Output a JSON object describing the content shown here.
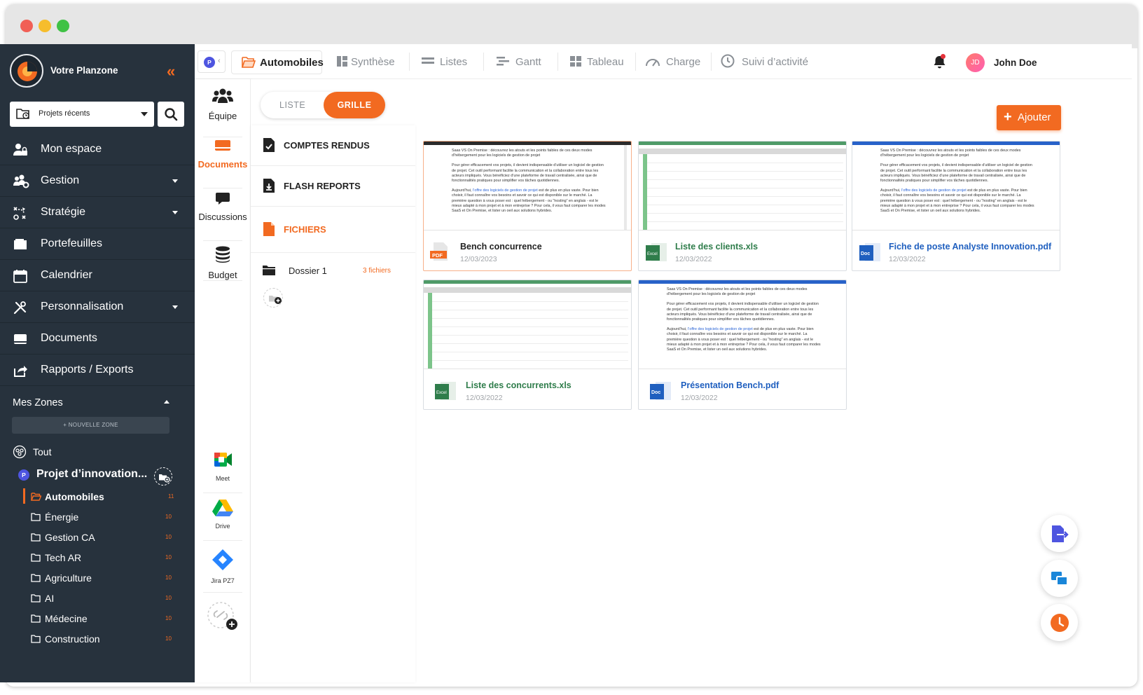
{
  "brand": {
    "name": "Votre Planzone"
  },
  "recent_projects": {
    "label": "Projets récents"
  },
  "nav": {
    "items": [
      {
        "label": "Mon espace",
        "icon": "user-lock-icon",
        "dropdown": false
      },
      {
        "label": "Gestion",
        "icon": "users-cog-icon",
        "dropdown": true
      },
      {
        "label": "Stratégie",
        "icon": "strategy-icon",
        "dropdown": true
      },
      {
        "label": "Portefeuilles",
        "icon": "folder-icon",
        "dropdown": false
      },
      {
        "label": "Calendrier",
        "icon": "calendar-icon",
        "dropdown": false
      },
      {
        "label": "Personnalisation",
        "icon": "tools-icon",
        "dropdown": true
      },
      {
        "label": "Documents",
        "icon": "document-tray-icon",
        "dropdown": false
      },
      {
        "label": "Rapports / Exports",
        "icon": "export-icon",
        "dropdown": false
      }
    ]
  },
  "zones": {
    "heading": "Mes Zones",
    "new_zone": "+ NOUVELLE ZONE",
    "all_label": "Tout",
    "project": {
      "badge": "P",
      "label": "Projet d’innovation..."
    },
    "items": [
      {
        "label": "Automobiles",
        "count": "11",
        "active": true
      },
      {
        "label": "Énergie",
        "count": "10",
        "active": false
      },
      {
        "label": "Gestion CA",
        "count": "10",
        "active": false
      },
      {
        "label": "Tech AR",
        "count": "10",
        "active": false
      },
      {
        "label": "Agriculture",
        "count": "10",
        "active": false
      },
      {
        "label": "AI",
        "count": "10",
        "active": false
      },
      {
        "label": "Médecine",
        "count": "10",
        "active": false
      },
      {
        "label": "Construction",
        "count": "10",
        "active": false
      }
    ]
  },
  "topbar": {
    "project_badge": "P",
    "tabs": [
      {
        "label": "Automobiles",
        "icon": "folder-open-icon",
        "active": true
      },
      {
        "label": "Synthèse",
        "icon": "synthesis-icon",
        "active": false
      },
      {
        "label": "Listes",
        "icon": "list-icon",
        "active": false
      },
      {
        "label": "Gantt",
        "icon": "gantt-icon",
        "active": false
      },
      {
        "label": "Tableau",
        "icon": "board-icon",
        "active": false
      },
      {
        "label": "Charge",
        "icon": "gauge-icon",
        "active": false
      },
      {
        "label": "Suivi d’activité",
        "icon": "clock-icon",
        "active": false
      }
    ],
    "user": {
      "initials": "JD",
      "name": "John Doe"
    }
  },
  "modules": [
    {
      "label": "Équipe",
      "icon": "team-icon",
      "active": false
    },
    {
      "label": "Documents",
      "icon": "documents-icon",
      "active": true
    },
    {
      "label": "Discussions",
      "icon": "chat-icon",
      "active": false
    },
    {
      "label": "Budget",
      "icon": "coins-icon",
      "active": false
    }
  ],
  "integrations": [
    {
      "label": "Meet",
      "icon": "google-meet-icon"
    },
    {
      "label": "Drive",
      "icon": "google-drive-icon"
    },
    {
      "label": "Jira PZ7",
      "icon": "jira-icon"
    }
  ],
  "view_toggle": {
    "list": "LISTE",
    "grid": "GRILLE",
    "selected": "grid"
  },
  "sections": [
    {
      "label": "COMPTES RENDUS",
      "icon": "report-doc-icon",
      "active": false
    },
    {
      "label": "FLASH REPORTS",
      "icon": "flash-report-icon",
      "active": false
    },
    {
      "label": "FICHIERS",
      "icon": "files-icon",
      "active": true
    }
  ],
  "folder": {
    "label": "Dossier 1",
    "count": "3 fichiers"
  },
  "add_button": {
    "label": "Ajouter"
  },
  "doc_preview": {
    "line1": "Saas VS On Premise : découvrez les atouts et les points faibles de ces deux modes d’hébergement pour les logiciels de gestion de projet",
    "line2": "Pour gérer efficacement vos projets, il devient indispensable d’utiliser un logiciel de gestion de projet. Cet outil performant facilite la communication et la collaboration entre tous les acteurs impliqués. Vous bénéficiez d’une plateforme de travail centralisée, ainsi que de fonctionnalités pratiques pour simplifier vos tâches quotidiennes.",
    "line3_pre": "Aujourd’hui, ",
    "line3_link": "l’offre des logiciels de gestion de projet",
    "line3_post": " est de plus en plus vaste. Pour bien choisir, il faut connaître vos besoins et savoir ce qui est disponible sur le marché. La première question à vous poser est : quel hébergement - ou “hosting” en anglais - est le mieux adapté à mon projet et à mon entreprise ? Pour cela, il vous faut comparer les modes SaaS et On Premise, et lister un oeil aux solutions hybrides."
  },
  "files": [
    {
      "name": "Bench concurrence",
      "date": "12/03/2023",
      "type": "pdf",
      "badge": "PDF",
      "preview": "doc"
    },
    {
      "name": "Liste des clients.xls",
      "date": "12/03/2022",
      "type": "xls",
      "badge": "Excel",
      "preview": "sheet"
    },
    {
      "name": "Fiche de poste Analyste Innovation.pdf",
      "date": "12/03/2022",
      "type": "doc",
      "badge": "Doc",
      "preview": "doc"
    },
    {
      "name": "Liste des concurrents.xls",
      "date": "12/03/2022",
      "type": "xls",
      "badge": "Excel",
      "preview": "sheet"
    },
    {
      "name": "Présentation Bench.pdf",
      "date": "12/03/2022",
      "type": "doc",
      "badge": "Doc",
      "preview": "doc"
    }
  ],
  "colors": {
    "accent": "#f26a21",
    "sidebar": "#27323d",
    "excel": "#2f7d4b",
    "doc": "#1f5fbf"
  }
}
